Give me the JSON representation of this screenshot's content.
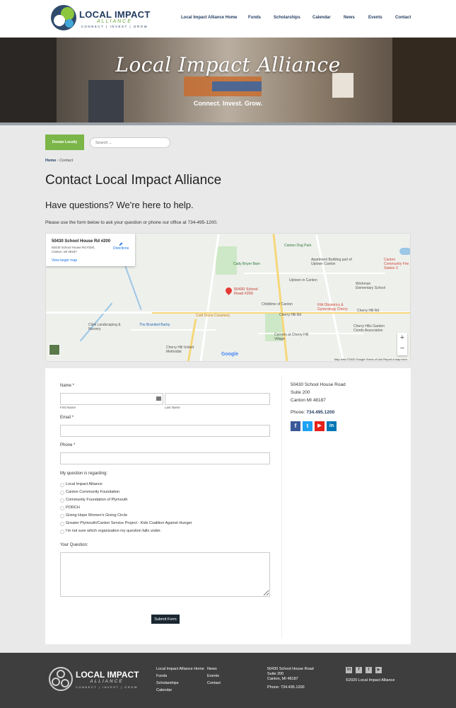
{
  "header": {
    "logo": {
      "name": "LOCAL IMPACT",
      "sub": "ALLIANCE",
      "tagline": "CONNECT | INVEST | GROW"
    },
    "nav": [
      "Local Impact Alliance Home",
      "Funds",
      "Scholarships",
      "Calendar",
      "News",
      "Events",
      "Contact"
    ]
  },
  "hero": {
    "title": "Local Impact Alliance",
    "subtitle": "Connect. Invest. Grow."
  },
  "toolbar": {
    "donate_label": "Donate Locally",
    "search_placeholder": "Search ..."
  },
  "breadcrumb": {
    "home": "Home",
    "sep": "›",
    "current": "Contact"
  },
  "page": {
    "title": "Contact Local Impact Alliance",
    "subtitle": "Have questions? We're here to help.",
    "intro": "Please use the form below to ask your question or phone our office at 734-495-1200."
  },
  "map": {
    "card_title": "50430 School House Rd #200",
    "card_address": "50430 School House Rd #200, Canton, MI 48187",
    "directions": "Directions",
    "larger_map": "View larger map",
    "pin_label": "50430 School Road #200",
    "labels": [
      "Canton Dog Park",
      "Cady Boyer Barn",
      "Apartment Building part of Uptown Canton",
      "Canton Community Fire Station 3",
      "Uptown in Canton",
      "Workman Elementary School",
      "Childtime of Canton",
      "IHA Obstetrics & Gynecology Cherry",
      "Cherry Hill Rd",
      "Cold Stone Creamery",
      "Clink Landscaping & Nursery",
      "The Branded Barby",
      "Corners at Cherry Hill Village",
      "Cherry Hills Garden Condo Association",
      "Cherry Hill United Methodist",
      "Cherry Hill Rd"
    ],
    "footer": "Map data ©2020 Google   Terms of Use   Report a map error",
    "google": "Google",
    "zoom_in": "+",
    "zoom_out": "−"
  },
  "form": {
    "name_label": "Name *",
    "first_label": "First Name",
    "last_label": "Last Name",
    "email_label": "Email *",
    "phone_label": "Phone *",
    "regarding_label": "My question is regarding:",
    "options": [
      "Local Impact Alliance",
      "Canton Community Foundation",
      "Community Foundation of Plymouth",
      "PORCH",
      "Giving Hope Women's Giving Circle",
      "Greater Plymouth/Canton Service Project - Kids Coalition Against Hunger",
      "I'm not sure which organization my question falls under."
    ],
    "question_label": "Your Question:",
    "submit_label": "Submit Form"
  },
  "contact": {
    "line1": "50430 School House Road",
    "line2": "Suite 200",
    "line3": "Canton MI 48187",
    "phone_label": "Phone:",
    "phone": "734.495.1200",
    "social": [
      {
        "icon": "facebook-icon",
        "glyph": "f",
        "color": "#3b5998"
      },
      {
        "icon": "twitter-icon",
        "glyph": "t",
        "color": "#1da1f2"
      },
      {
        "icon": "youtube-icon",
        "glyph": "▶",
        "color": "#e62117"
      },
      {
        "icon": "linkedin-icon",
        "glyph": "in",
        "color": "#0077b5"
      }
    ]
  },
  "footer": {
    "logo": {
      "name": "LOCAL IMPACT",
      "sub": "ALLIANCE",
      "tagline": "CONNECT | INVEST | GROW"
    },
    "links_col1": [
      "Local Impact Alliance Home",
      "Funds",
      "Scholarships",
      "Calendar"
    ],
    "links_col2": [
      "News",
      "Events",
      "Contact"
    ],
    "address1": "50430 School House Road",
    "address2": "Suite 200",
    "address3": "Canton, MI 48187",
    "phone": "Phone: 734.495.1200",
    "copyright": "©2020 Local Impact Alliance",
    "social": [
      "in",
      "f",
      "t",
      "▶"
    ]
  }
}
